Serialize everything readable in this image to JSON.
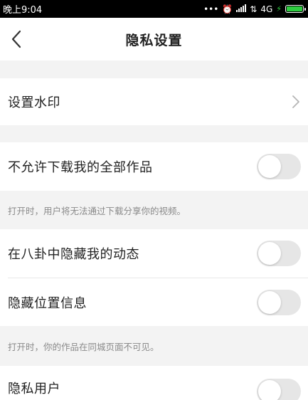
{
  "status_bar": {
    "time": "晚上9:04",
    "network": "4G",
    "battery_color": "#2ecc40"
  },
  "nav": {
    "title": "隐私设置",
    "back_icon": "chevron-left-icon"
  },
  "rows": {
    "watermark": {
      "label": "设置水印"
    },
    "disable_download": {
      "label": "不允许下载我的全部作品",
      "on": false
    },
    "hide_gossip": {
      "label": "在八卦中隐藏我的动态",
      "on": false
    },
    "hide_location": {
      "label": "隐藏位置信息",
      "on": false
    },
    "private_user": {
      "label": "隐私用户",
      "on": false
    }
  },
  "hints": {
    "download": "打开时，用户将无法通过下载分享你的视频。",
    "location": "打开时，你的作品在同城页面不可见。"
  },
  "colors": {
    "section_gap": "#f3f3f3",
    "toggle_off": "#e6e6e6",
    "hint_text": "#8a8a8a"
  }
}
